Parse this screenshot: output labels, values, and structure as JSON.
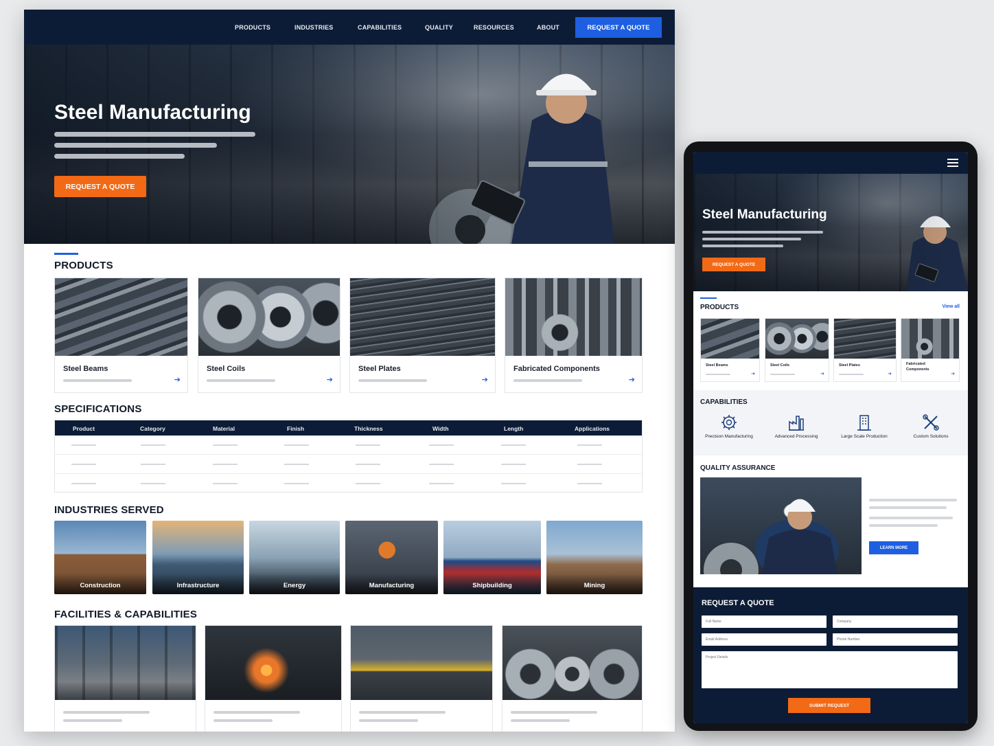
{
  "desktop": {
    "nav": {
      "links": [
        "PRODUCTS",
        "INDUSTRIES",
        "CAPABILITIES",
        "QUALITY",
        "RESOURCES",
        "ABOUT"
      ],
      "cta": "REQUEST A QUOTE"
    },
    "hero": {
      "title": "Steel Manufacturing",
      "cta": "REQUEST A QUOTE"
    },
    "products": {
      "heading": "PRODUCTS",
      "items": [
        {
          "name": "Steel Beams"
        },
        {
          "name": "Steel Coils"
        },
        {
          "name": "Steel Plates"
        },
        {
          "name": "Fabricated Components"
        }
      ]
    },
    "specifications": {
      "heading": "SPECIFICATIONS",
      "columns": [
        "Product",
        "Category",
        "Material",
        "Finish",
        "Thickness",
        "Width",
        "Length",
        "Applications"
      ]
    },
    "industries": {
      "heading": "INDUSTRIES SERVED",
      "items": [
        "Construction",
        "Infrastructure",
        "Energy",
        "Manufacturing",
        "Shipbuilding",
        "Mining"
      ]
    },
    "facilities": {
      "heading": "FACILITIES & CAPABILITIES"
    }
  },
  "tablet": {
    "hero": {
      "title": "Steel Manufacturing",
      "cta": "REQUEST A QUOTE"
    },
    "products": {
      "heading": "PRODUCTS",
      "view_all": "View all",
      "items": [
        "Steel Beams",
        "Steel Coils",
        "Steel Plates",
        "Fabricated Components"
      ]
    },
    "capabilities": {
      "heading": "CAPABILITIES",
      "items": [
        {
          "label": "Precision Manufacturing",
          "icon": "gear-icon"
        },
        {
          "label": "Advanced Processing",
          "icon": "factory-icon"
        },
        {
          "label": "Large Scale Production",
          "icon": "building-icon"
        },
        {
          "label": "Custom Solutions",
          "icon": "tools-icon"
        }
      ]
    },
    "quality": {
      "heading": "QUALITY ASSURANCE",
      "cta": "LEARN MORE"
    },
    "quote": {
      "heading": "REQUEST A QUOTE",
      "fields": {
        "full_name": "Full Name",
        "company": "Company",
        "email": "Email Address",
        "phone": "Phone Number",
        "details": "Project Details"
      },
      "submit": "SUBMIT REQUEST"
    }
  },
  "colors": {
    "navy": "#0d1c36",
    "accent_blue": "#1d5fe0",
    "accent_orange": "#f26a16"
  }
}
